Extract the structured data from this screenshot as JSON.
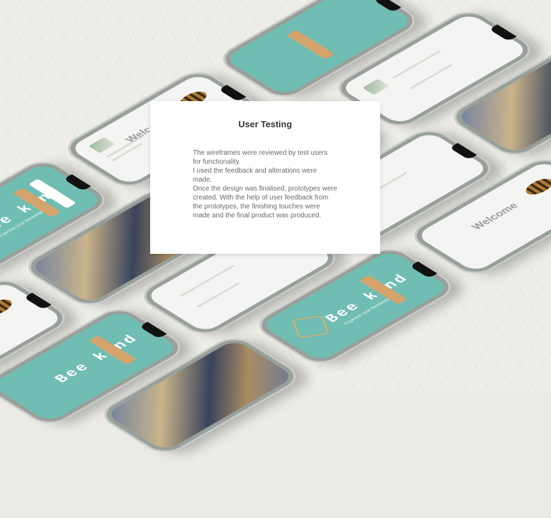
{
  "card": {
    "title": "User Testing",
    "paragraphs": [
      "The wireframes were reviewed  by test users for functionality.",
      "I used the feedback and alterations were made.",
      "Once the design was finalised, prototypes were created. With the help of user feedback from the  prototypes, the finishing touches were made and the final product was produced."
    ]
  },
  "mockups": {
    "app_name": "Bee kind",
    "tagline": "Organise your Beekeeping",
    "welcome": "Welcome"
  },
  "colors": {
    "teal": "#6fbdb3",
    "gold": "#d4a46c",
    "card_bg": "#ffffff",
    "text": "#6a6a6a"
  }
}
